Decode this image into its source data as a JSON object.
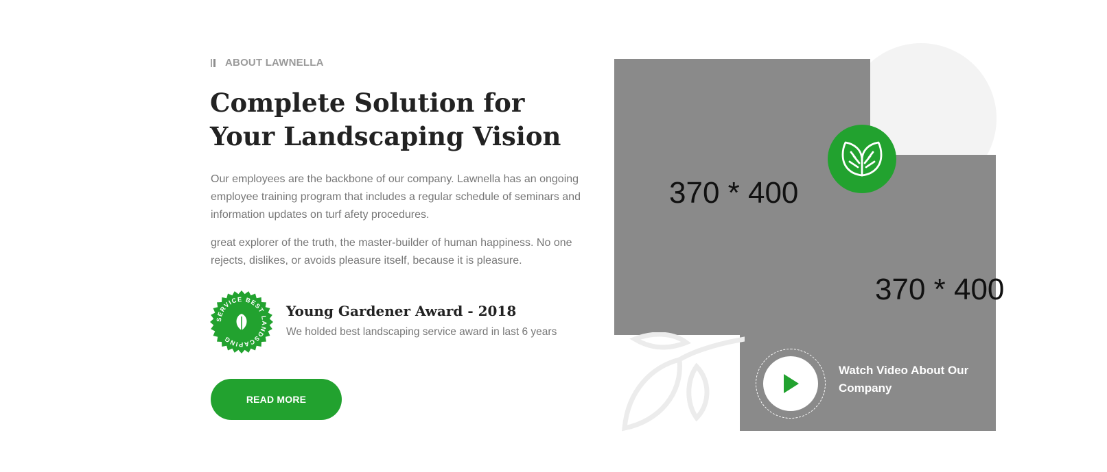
{
  "about": {
    "subtitle": "ABOUT LAWNELLA",
    "heading": "Complete Solution for Your Landscaping Vision",
    "paragraph1": "Our employees are the backbone of our company. Lawnella has an ongoing employee training program that includes a regular schedule of seminars and information updates on turf afety procedures.",
    "paragraph2": "great explorer of the truth, the master-builder of human happiness. No one rejects, dislikes, or avoids pleasure itself, because it is pleasure.",
    "award": {
      "badge_text": "SERVICE BEST LANDSCAPING",
      "title": "Young Gardener Award - 2018",
      "description": "We holded best landscaping service award in last 6 years"
    },
    "button_label": "READ MORE"
  },
  "media": {
    "image1_placeholder": "370 * 400",
    "image2_placeholder": "370 * 400",
    "video_label": "Watch Video About Our Company"
  },
  "colors": {
    "brand_green": "#22a22f",
    "placeholder_gray": "#8a8a8a",
    "heading": "#222222",
    "body_text": "#777777"
  },
  "icons": {
    "subtitle_marker": "double-bar-icon",
    "award_badge": "leaf-seal-icon",
    "feature_badge": "leaves-icon",
    "video_button": "play-icon",
    "decoration": "leaf-outline-icon"
  }
}
